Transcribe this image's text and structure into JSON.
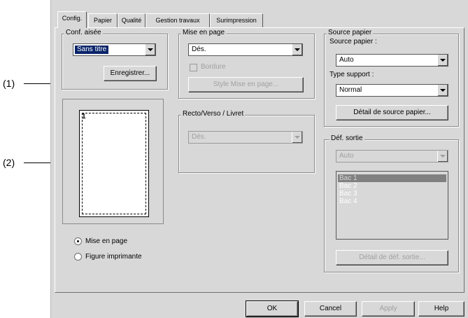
{
  "callouts": {
    "c1": "(1)",
    "c2": "(2)"
  },
  "tabs": [
    "Config.",
    "Papier",
    "Qualité",
    "Gestion travaux",
    "Surimpression"
  ],
  "conf_aisee": {
    "title": "Conf. aisée",
    "combo_value": "Sans titre",
    "save_button": "Enregistrer..."
  },
  "preview": {
    "page_number": "1"
  },
  "view_mode": {
    "options": [
      "Mise en page",
      "Figure imprimante"
    ],
    "selected": "Mise en page"
  },
  "mise_en_page": {
    "title": "Mise en page",
    "combo_value": "Dés.",
    "border_label": "Bordure",
    "style_button": "Style Mise en page..."
  },
  "recto_verso": {
    "title": "Recto/Verso / Livret",
    "combo_value": "Dés."
  },
  "source_papier": {
    "title": "Source papier",
    "source_label": "Source papier :",
    "source_value": "Auto",
    "type_label": "Type support :",
    "type_value": "Normal",
    "detail_button": "Détail de source papier..."
  },
  "def_sortie": {
    "title": "Déf. sortie",
    "combo_value": "Auto",
    "list": [
      "Bac 1",
      "Bac 2",
      "Bac 3",
      "Bac 4"
    ],
    "detail_button": "Détail de déf. sortie..."
  },
  "footer": {
    "ok": "OK",
    "cancel": "Cancel",
    "apply": "Apply",
    "help": "Help"
  }
}
